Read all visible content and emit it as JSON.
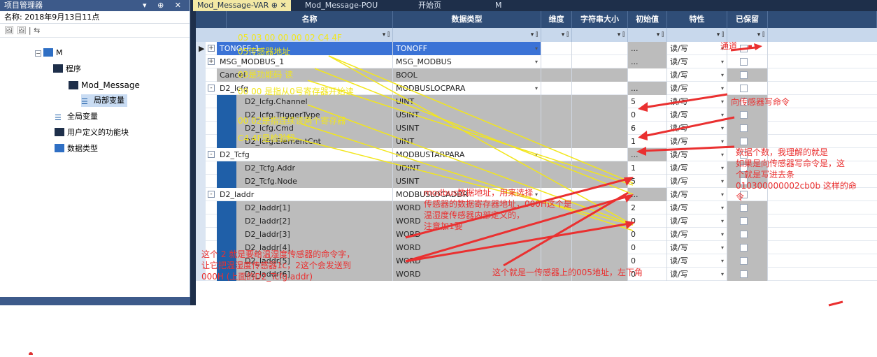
{
  "project_manager": {
    "title": "项目管理器",
    "controls": "▾ ⊕ ✕",
    "name_line": "名称: 2018年9月13日11点",
    "toolbar": "🖼 🖼 | ⇆",
    "tree": [
      {
        "label": "M",
        "name": "tree-root-m"
      },
      {
        "label": "程序",
        "name": "tree-program"
      },
      {
        "label": "Mod_Message",
        "name": "tree-mod-message"
      },
      {
        "label": "局部变量",
        "name": "tree-local-vars"
      },
      {
        "label": "全局变量",
        "name": "tree-global-vars"
      },
      {
        "label": "用户定义的功能块",
        "name": "tree-user-fb"
      },
      {
        "label": "数据类型",
        "name": "tree-data-types"
      }
    ]
  },
  "tabs": [
    {
      "label": "Mod_Message-VAR  ⊕ ✕"
    },
    {
      "label": "Mod_Message-POU"
    },
    {
      "label": "开始页"
    },
    {
      "label": "M"
    }
  ],
  "columns": [
    "名称",
    "数据类型",
    "维度",
    "字符串大小",
    "初始值",
    "特性",
    "已保留"
  ],
  "filter_icon": "▾ ⫿",
  "rows": [
    {
      "name": "TONOFF_1",
      "type": "TONOFF",
      "init": "...",
      "attr": "读/写",
      "expand": "+",
      "level": 0,
      "selected": true
    },
    {
      "name": "MSG_MODBUS_1",
      "type": "MSG_MODBUS",
      "init": "...",
      "attr": "读/写",
      "expand": "+",
      "level": 0
    },
    {
      "name": "Cancel",
      "type": "BOOL",
      "init": "",
      "attr": "读/写",
      "expand": "",
      "level": 0,
      "gray": true
    },
    {
      "name": "D2_lcfg",
      "type": "MODBUSLOCPARA",
      "init": "...",
      "attr": "读/写",
      "expand": "-",
      "level": 0
    },
    {
      "name": "D2_lcfg.Channel",
      "type": "UINT",
      "init": "5",
      "attr": "读/写",
      "expand": "",
      "level": 1,
      "gray": true
    },
    {
      "name": "D2_lcfg.TriggerType",
      "type": "USINT",
      "init": "0",
      "attr": "读/写",
      "expand": "",
      "level": 1,
      "gray": true
    },
    {
      "name": "D2_lcfg.Cmd",
      "type": "USINT",
      "init": "6",
      "attr": "读/写",
      "expand": "",
      "level": 1,
      "gray": true
    },
    {
      "name": "D2_lcfg.ElementCnt",
      "type": "UINT",
      "init": "1",
      "attr": "读/写",
      "expand": "",
      "level": 1,
      "gray": true
    },
    {
      "name": "D2_Tcfg",
      "type": "MODBUSTARPARA",
      "init": "...",
      "attr": "读/写",
      "expand": "-",
      "level": 0
    },
    {
      "name": "D2_Tcfg.Addr",
      "type": "UDINT",
      "init": "1",
      "attr": "读/写",
      "expand": "",
      "level": 1,
      "gray": true
    },
    {
      "name": "D2_Tcfg.Node",
      "type": "USINT",
      "init": "5",
      "attr": "读/写",
      "expand": "",
      "level": 1,
      "gray": true
    },
    {
      "name": "D2_laddr",
      "type": "MODBUSLOCADDR",
      "init": "...",
      "attr": "读/写",
      "expand": "-",
      "level": 0
    },
    {
      "name": "D2_laddr[1]",
      "type": "WORD",
      "init": "2",
      "attr": "读/写",
      "expand": "",
      "level": 1,
      "gray": true
    },
    {
      "name": "D2_laddr[2]",
      "type": "WORD",
      "init": "0",
      "attr": "读/写",
      "expand": "",
      "level": 1,
      "gray": true
    },
    {
      "name": "D2_laddr[3]",
      "type": "WORD",
      "init": "0",
      "attr": "读/写",
      "expand": "",
      "level": 1,
      "gray": true
    },
    {
      "name": "D2_laddr[4]",
      "type": "WORD",
      "init": "0",
      "attr": "读/写",
      "expand": "",
      "level": 1,
      "gray": true
    },
    {
      "name": "D2_laddr[5]",
      "type": "WORD",
      "init": "0",
      "attr": "读/写",
      "expand": "",
      "level": 1,
      "gray": true
    },
    {
      "name": "D2_laddr[6]",
      "type": "WORD",
      "init": "0",
      "attr": "读/写",
      "expand": "",
      "level": 1,
      "gray": true
    }
  ],
  "annotations_yellow": [
    "05 03 00 00 00 02 C4 4F",
    "05传感器地址",
    "03是功能码 读",
    "00 00 是指从0号寄存器开始读",
    "00 02是指连续读两个寄存器",
    "C4 4F是检验码"
  ],
  "annotations_red": {
    "channel": "通道",
    "write_cmd": "向传感器写命令",
    "element_cnt": "数据个数，我理解的就是\n如果是向传感器写命令是，这\n个就是写进去条\n010300000002cb0b 这样的命\n令",
    "modbus_addr": "modbus数据地址，用来选择\n传感器的数据寄存器地址，000H这个是\n温湿度传感器内部定义的，\n注意加1要",
    "cmd_word": "这个 2 就是要给温湿度传感器的命令字，\n让它把温湿度传感器1c，2这个会发送到\n000H (上面的D2_Tcfg.addr)",
    "node_addr": "这个就是一传感器上的005地址，左下角"
  },
  "colors": {
    "yellow": "#f2e61c",
    "red": "#ea3030",
    "header": "#2f4d77",
    "strip": "#1f5fa8"
  }
}
